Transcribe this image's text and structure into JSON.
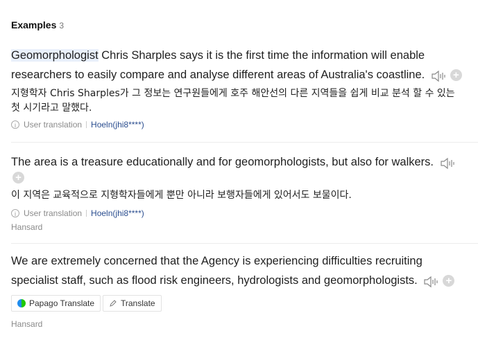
{
  "header": {
    "title": "Examples",
    "count": "3"
  },
  "examples": [
    {
      "en_highlight": "Geomorphologist",
      "en_rest_line1": " Chris Sharples says it is the first time the information will enable",
      "en_line2": "researchers to easily compare and analyse different areas of Australia's coastline.",
      "ko_line1": "지형학자 Chris Sharples가 그 정보는 연구원들에게 호주 해안선의 다른 지역들을 쉽게 비교 분석 할 수 있는",
      "ko_line2": "첫 시기라고 말했다.",
      "meta_label": "User translation",
      "meta_user": "Hoeln(jhi8****)"
    },
    {
      "en_line1": "The area is a treasure educationally and for geomorphologists, but also for walkers.",
      "ko_line1": "이 지역은 교육적으로 지형학자들에게 뿐만 아니라 보행자들에게 있어서도 보물이다.",
      "meta_label": "User translation",
      "meta_user": "Hoeln(jhi8****)",
      "source": "Hansard"
    },
    {
      "en_line1": "We are extremely concerned that the Agency is experiencing difficulties recruiting",
      "en_line2": "specialist staff, such as flood risk engineers, hydrologists and geomorphologists.",
      "papago_label": "Papago Translate",
      "translate_label": "Translate",
      "source": "Hansard"
    }
  ],
  "icons": {
    "speaker": "speaker-icon",
    "plus": "plus-icon",
    "info": "info-icon",
    "pencil": "pencil-icon",
    "papago": "papago-logo-icon"
  },
  "colors": {
    "highlight": "#e9f0fb",
    "user_link": "#2a4d8f",
    "muted": "#8a8a8a"
  }
}
